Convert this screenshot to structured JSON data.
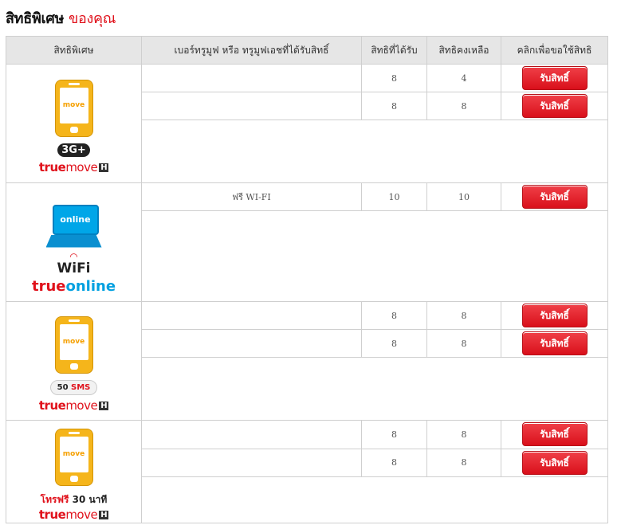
{
  "title": {
    "main": "สิทธิพิเศษ",
    "accent": "ของคุณ"
  },
  "table": {
    "headers": [
      "สิทธิพิเศษ",
      "เบอร์ทรูมูฟ หรือ ทรูมูฟเอชที่ได้รับสิทธิ์",
      "สิทธิที่ได้รับ",
      "สิทธิคงเหลือ",
      "คลิกเพื่อขอใช้สิทธิ"
    ],
    "claim_label": "รับสิทธิ์",
    "groups": [
      {
        "logo": {
          "screen": "move",
          "badge": "3G+",
          "brand_a": "true",
          "brand_b": "move",
          "brand_c": "H"
        },
        "rows": [
          {
            "number": "",
            "received": "8",
            "remaining": "4"
          },
          {
            "number": "",
            "received": "8",
            "remaining": "8"
          }
        ]
      },
      {
        "logo": {
          "screen": "online",
          "wifi": "WiFi",
          "brand_a": "true",
          "brand_b": "online"
        },
        "rows": [
          {
            "number": "ฟรี WI-FI",
            "received": "10",
            "remaining": "10"
          }
        ]
      },
      {
        "logo": {
          "screen": "move",
          "badge_num": "50",
          "badge_text": "SMS",
          "brand_a": "true",
          "brand_b": "move",
          "brand_c": "H"
        },
        "rows": [
          {
            "number": "",
            "received": "8",
            "remaining": "8"
          },
          {
            "number": "",
            "received": "8",
            "remaining": "8"
          }
        ]
      },
      {
        "logo": {
          "screen": "move",
          "call_a": "โทรฟรี",
          "call_b": "30 นาที",
          "brand_a": "true",
          "brand_b": "move",
          "brand_c": "H"
        },
        "rows": [
          {
            "number": "",
            "received": "8",
            "remaining": "8"
          },
          {
            "number": "",
            "received": "8",
            "remaining": "8"
          }
        ]
      }
    ]
  },
  "colors": {
    "accent": "#e0111b",
    "button": "#e8202a",
    "header_bg": "#e6e6e6",
    "border": "#cfcfcf"
  }
}
